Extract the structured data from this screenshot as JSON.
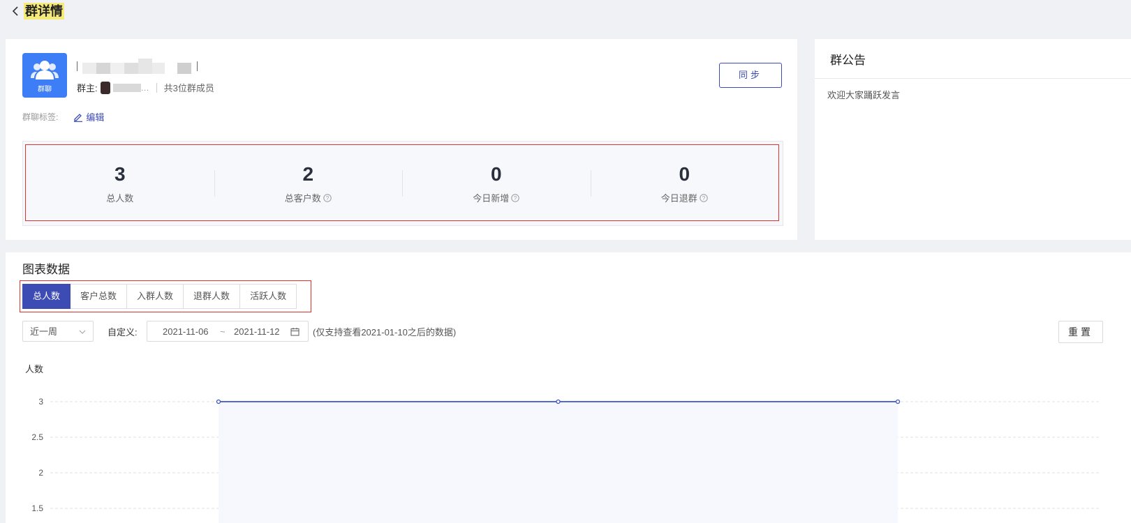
{
  "header": {
    "title": "群详情",
    "back_icon": "chevron-left-icon"
  },
  "group": {
    "avatar_label": "群聊",
    "owner_label": "群主:",
    "owner_name": "…",
    "member_count": "共3位群成员",
    "sync_label": "同步",
    "tags_label": "群聊标签:",
    "edit_label": "编辑"
  },
  "stats": [
    {
      "value": "3",
      "label": "总人数",
      "help": false
    },
    {
      "value": "2",
      "label": "总客户数",
      "help": true
    },
    {
      "value": "0",
      "label": "今日新增",
      "help": true
    },
    {
      "value": "0",
      "label": "今日退群",
      "help": true
    }
  ],
  "notice": {
    "title": "群公告",
    "text": "欢迎大家踊跃发言"
  },
  "chart_section": {
    "title": "图表数据",
    "tabs": [
      "总人数",
      "客户总数",
      "入群人数",
      "退群人数",
      "活跃人数"
    ],
    "active_tab": 0,
    "range_value": "近一周",
    "custom_label": "自定义:",
    "date_start": "2021-11-06",
    "date_sep": "~",
    "date_end": "2021-11-12",
    "date_note": "(仅支持查看2021-01-10之后的数据)",
    "reset_label": "重置"
  },
  "colors": {
    "accent": "#3d4bb5",
    "avatar_bg": "#3d7df5",
    "highlight_border": "#e0312f"
  },
  "chart_data": {
    "type": "line",
    "ylabel": "人数",
    "yticks": [
      "3",
      "2.5",
      "2",
      "1.5"
    ],
    "ylim": [
      1.5,
      3
    ],
    "series": [
      {
        "values": [
          3,
          3,
          3
        ]
      }
    ],
    "area_fill": true,
    "grid": true
  }
}
